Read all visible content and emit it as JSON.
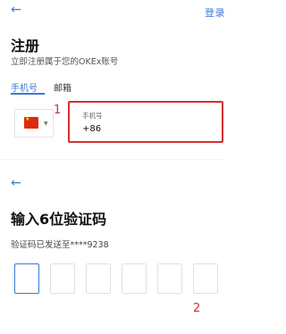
{
  "header": {
    "back_icon": "arrow-left-icon",
    "login_label": "登录"
  },
  "register": {
    "title": "注册",
    "subtitle": "立即注册属于您的OKEx账号"
  },
  "tabs": {
    "phone_label": "手机号",
    "email_label": "邮箱"
  },
  "country_selector": {
    "flag_icon": "china-flag-icon",
    "dropdown_icon": "caret-down-icon"
  },
  "phone_field": {
    "label": "手机号",
    "value": "+86"
  },
  "annotations": {
    "marker_1": "1",
    "marker_2": "2"
  },
  "verify": {
    "back_icon": "arrow-left-icon",
    "title": "输入6位验证码",
    "sent_text": "验证码已发送至****9238",
    "code_boxes": [
      "",
      "",
      "",
      "",
      "",
      ""
    ]
  },
  "colors": {
    "accent": "#3a78d6",
    "highlight": "#d32f2f"
  }
}
